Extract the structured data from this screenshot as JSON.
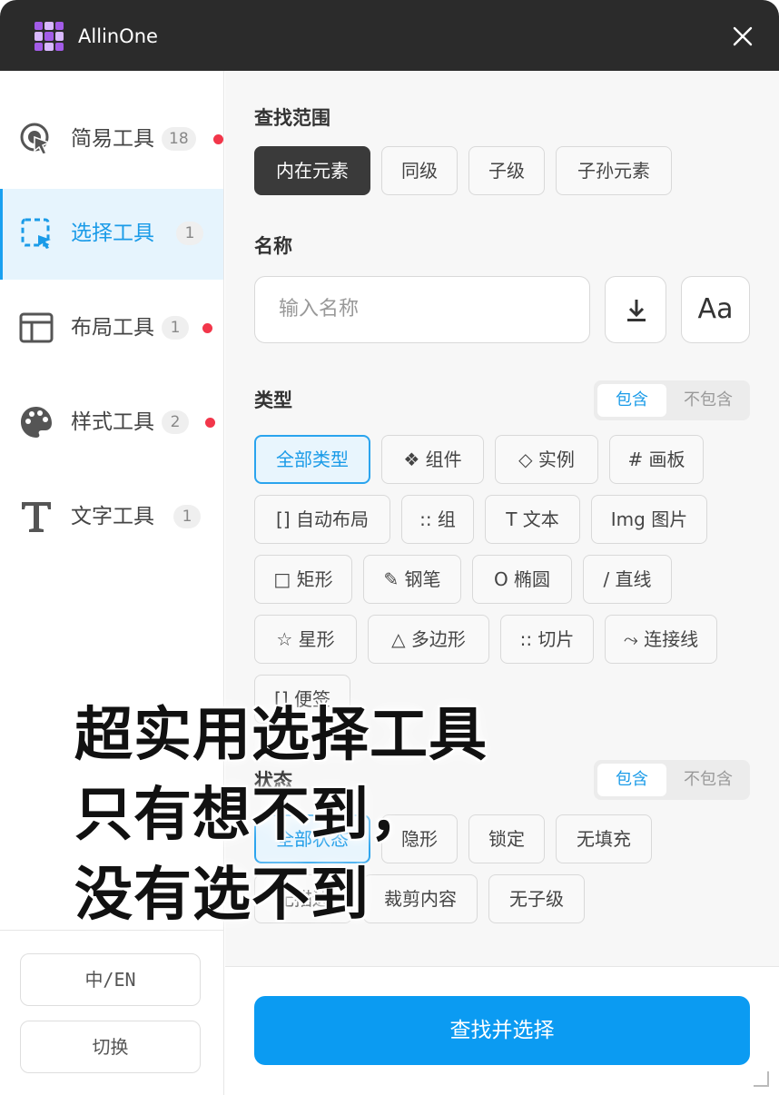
{
  "window": {
    "title": "AllinOne"
  },
  "sidebar": {
    "items": [
      {
        "label": "简易工具",
        "badge": "18",
        "dot": true,
        "icon": "cursor-target-icon"
      },
      {
        "label": "选择工具",
        "badge": "1",
        "dot": false,
        "icon": "selection-icon",
        "active": true
      },
      {
        "label": "布局工具",
        "badge": "1",
        "dot": true,
        "icon": "layout-icon"
      },
      {
        "label": "样式工具",
        "badge": "2",
        "dot": true,
        "icon": "palette-icon"
      },
      {
        "label": "文字工具",
        "badge": "1",
        "dot": false,
        "icon": "text-icon"
      }
    ],
    "lang_label": "中/EN",
    "switch_label": "切换"
  },
  "scope": {
    "title": "查找范围",
    "options": [
      "内在元素",
      "同级",
      "子级",
      "子孙元素"
    ],
    "selected": "内在元素"
  },
  "name": {
    "title": "名称",
    "placeholder": "输入名称",
    "case_label": "Aa"
  },
  "type": {
    "title": "类型",
    "include": "包含",
    "exclude": "不包含",
    "options": [
      "全部类型",
      "❖ 组件",
      "◇ 实例",
      "# 画板",
      "[] 自动布局",
      ":: 组",
      "T 文本",
      "Img 图片",
      "□ 矩形",
      "✎ 钢笔",
      "O 椭圆",
      "/ 直线",
      "☆ 星形",
      "△ 多边形",
      ":: 切片",
      "⤳ 连接线",
      "[] 便签"
    ],
    "selected": "全部类型"
  },
  "state": {
    "title": "状态",
    "include": "包含",
    "exclude": "不包含",
    "options": [
      "全部状态",
      "隐形",
      "锁定",
      "无填充",
      "无描边",
      "裁剪内容",
      "无子级"
    ],
    "selected": "全部状态"
  },
  "action": {
    "label": "查找并选择"
  },
  "promo": {
    "line1": "超实用选择工具",
    "line2": "只有想不到，",
    "line3": "没有选不到"
  },
  "colors": {
    "accent": "#0b9bf2",
    "titlebar": "#2b2b2b",
    "dot": "#f2364a",
    "brand": "#a35ce8"
  }
}
